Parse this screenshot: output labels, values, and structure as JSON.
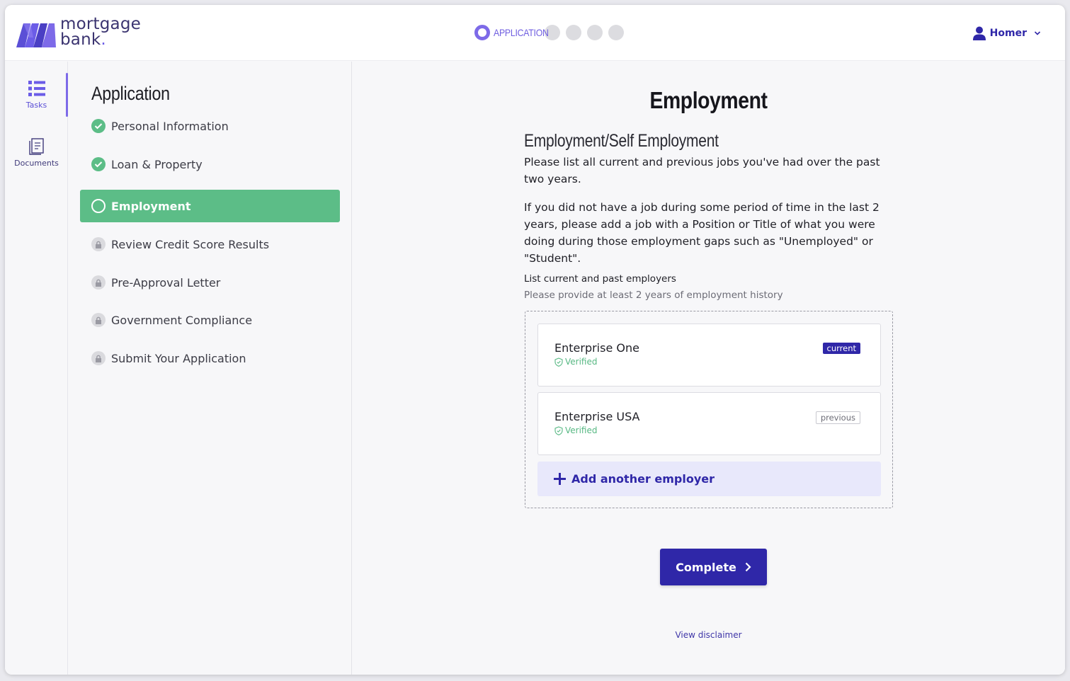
{
  "brand": {
    "line1": "mortgage",
    "line2": "bank",
    "dot": "."
  },
  "progress": {
    "active_label": "APPLICATION",
    "remaining_steps": 4
  },
  "user": {
    "name": "Homer"
  },
  "rail": {
    "tasks": "Tasks",
    "documents": "Documents"
  },
  "panel": {
    "title": "Application",
    "tasks": [
      {
        "label": "Personal Information",
        "status": "done"
      },
      {
        "label": "Loan & Property",
        "status": "done"
      },
      {
        "label": "Employment",
        "status": "active"
      },
      {
        "label": "Review Credit Score Results",
        "status": "locked"
      },
      {
        "label": "Pre-Approval Letter",
        "status": "locked"
      },
      {
        "label": "Government Compliance",
        "status": "locked"
      },
      {
        "label": "Submit Your Application",
        "status": "locked"
      }
    ]
  },
  "main": {
    "title": "Employment",
    "section_title": "Employment/Self Employment",
    "para1": "Please list all current and previous jobs you've had over the past two years.",
    "para2": "If you did not have a job during some period of time in the last 2 years, please add a job with a Position or Title of what you were doing during those employment gaps such as \"Unemployed\" or \"Student\".",
    "list_label": "List current and past employers",
    "list_hint": "Please provide at least 2 years of employment history",
    "employers": [
      {
        "name": "Enterprise One",
        "verified": "Verified",
        "badge": "current"
      },
      {
        "name": "Enterprise USA",
        "verified": "Verified",
        "badge": "previous"
      }
    ],
    "add_employer": "Add another employer",
    "complete": "Complete",
    "disclaimer": "View disclaimer"
  },
  "colors": {
    "accent": "#2f27a8",
    "success": "#5cbd87",
    "brand_purple": "#6b5ce7"
  }
}
